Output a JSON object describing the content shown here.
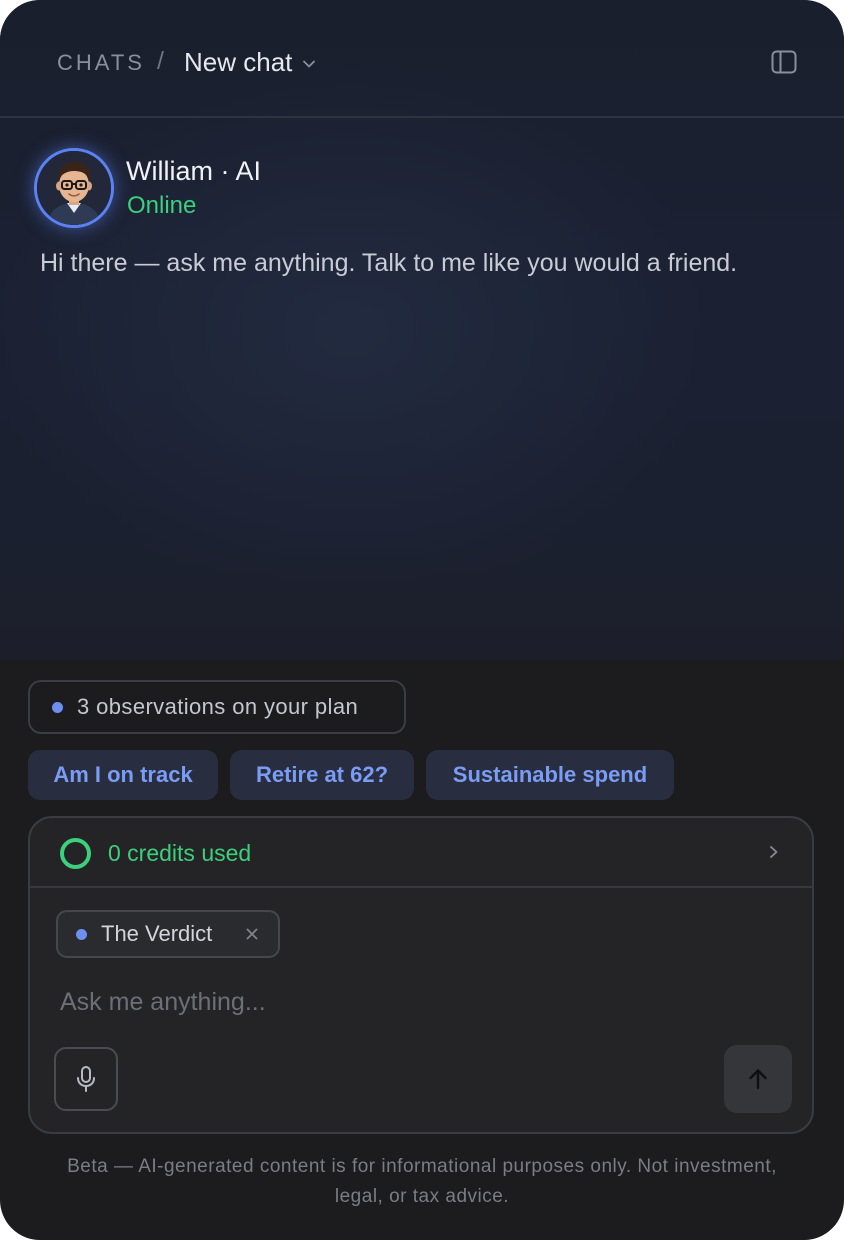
{
  "header": {
    "breadcrumb_root": "CHATS",
    "breadcrumb_separator": "/",
    "breadcrumb_current": "New chat"
  },
  "assistant": {
    "name": "William · AI",
    "status": "Online",
    "greeting": "Hi there — ask me anything. Talk to me like you would a friend."
  },
  "observations": {
    "label": "3 observations on your plan"
  },
  "suggestions": [
    {
      "label": "Am I on track"
    },
    {
      "label": "Retire at 62?"
    },
    {
      "label": "Sustainable spend"
    }
  ],
  "composer": {
    "credits_label": "0 credits used",
    "context_tag": "The Verdict",
    "input_placeholder": "Ask me anything...",
    "input_value": ""
  },
  "footer": {
    "disclaimer": "Beta — AI-generated content is for informational purposes only. Not investment, legal, or tax advice."
  },
  "colors": {
    "accent_blue": "#5b82f5",
    "status_green": "#3ccf7c",
    "chip_text": "#7a9cf5",
    "chip_bg": "#282e40"
  },
  "icons": {
    "avatar": "avatar-illustration",
    "sidebar_toggle": "sidebar-panel-icon",
    "dropdown": "chevron-down-icon",
    "credits": "ring-icon",
    "credits_expand": "chevron-right-icon",
    "tag_remove": "close-icon",
    "mic": "microphone-icon",
    "send": "arrow-up-icon"
  }
}
